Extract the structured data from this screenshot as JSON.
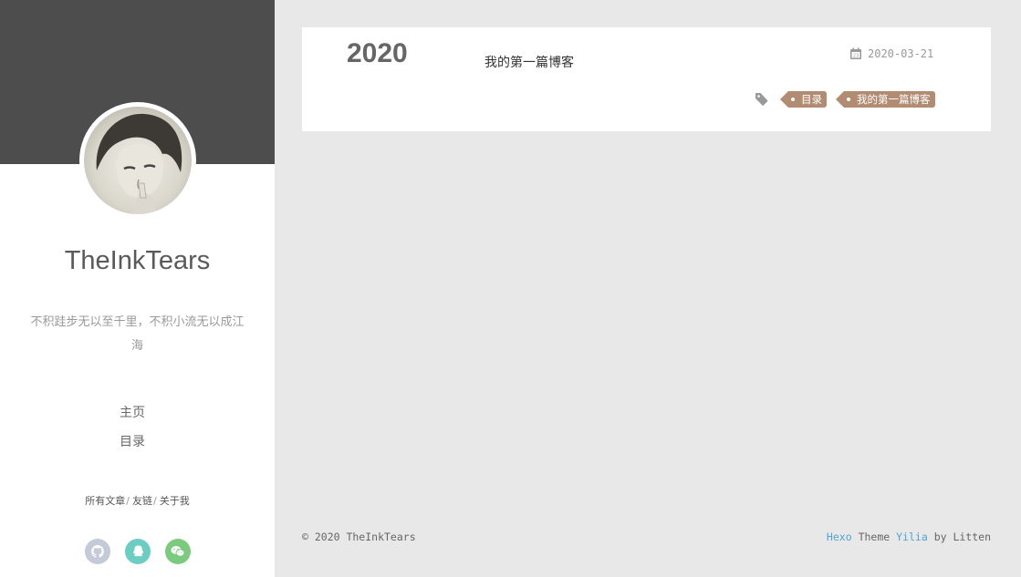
{
  "sidebar": {
    "site_title": "TheInkTears",
    "motto": "不积跬步无以至千里，不积小流无以成江海",
    "nav": [
      "主页",
      "目录"
    ],
    "links": [
      "所有文章",
      "友链",
      "关于我"
    ],
    "social": [
      {
        "name": "github-icon",
        "color": "#c5cad8"
      },
      {
        "name": "qq-icon",
        "color": "#6ccdc2"
      },
      {
        "name": "wechat-icon",
        "color": "#7bcb7e"
      }
    ]
  },
  "post": {
    "year": "2020",
    "title": "我的第一篇博客",
    "date": "2020-03-21",
    "tags": [
      "目录",
      "我的第一篇博客"
    ]
  },
  "footer": {
    "copyright": "© 2020 TheInkTears",
    "hexo": "Hexo",
    "theme": "Theme",
    "yilia": "Yilia",
    "by": "by Litten"
  },
  "colors": {
    "tag": "#b18b72",
    "link": "#4ea4d4",
    "header": "#4d4d4d"
  }
}
